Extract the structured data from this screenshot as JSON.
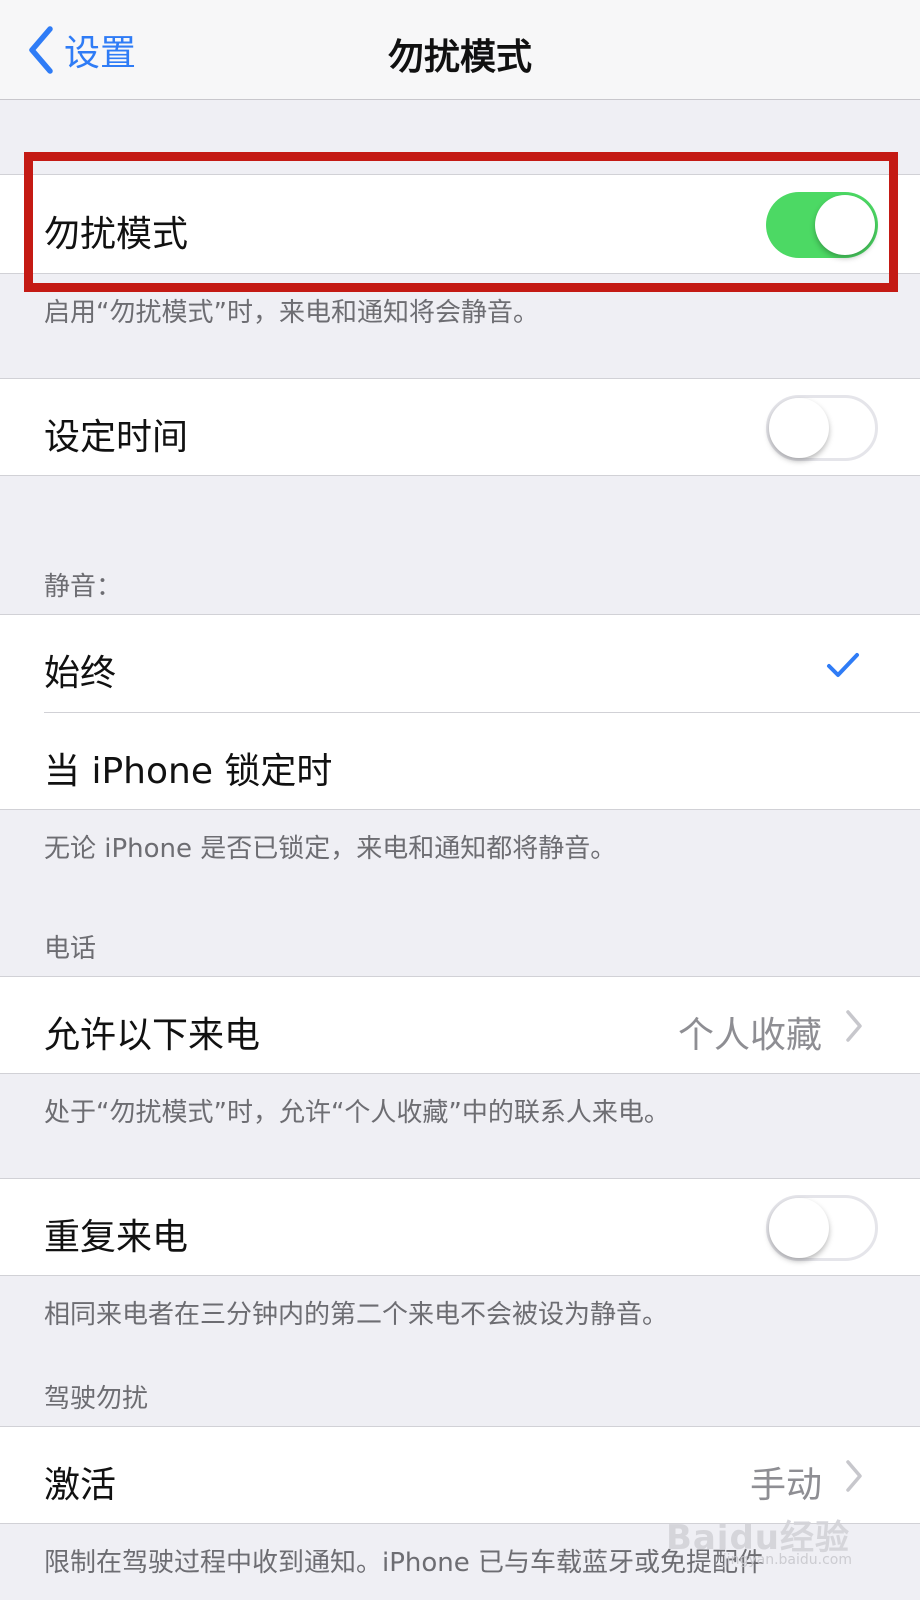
{
  "navbar": {
    "back_label": "设置",
    "title": "勿扰模式"
  },
  "dnd": {
    "label": "勿扰模式",
    "toggle_on": true,
    "footer": "启用“勿扰模式”时，来电和通知将会静音。"
  },
  "scheduled": {
    "label": "设定时间",
    "toggle_on": false
  },
  "silence": {
    "header": "静音：",
    "options": [
      "始终",
      "当 iPhone 锁定时"
    ],
    "selected": "始终",
    "footer": "无论 iPhone 是否已锁定，来电和通知都将静音。"
  },
  "phone": {
    "header": "电话",
    "allow_calls_label": "允许以下来电",
    "allow_calls_value": "个人收藏",
    "footer": "处于“勿扰模式”时，允许“个人收藏”中的联系人来电。"
  },
  "repeated": {
    "label": "重复来电",
    "toggle_on": false,
    "footer": "相同来电者在三分钟内的第二个来电不会被设为静音。"
  },
  "driving": {
    "header": "驾驶勿扰",
    "activate_label": "激活",
    "activate_value": "手动",
    "footer": "限制在驾驶过程中收到通知。iPhone 已与车载蓝牙或免提配件"
  },
  "watermark": {
    "text": "Baidu经验",
    "sub": "jingyan.baidu.com"
  },
  "colors": {
    "accent": "#2f7cf6",
    "toggle_on": "#4cd964",
    "highlight": "#c41a14"
  }
}
